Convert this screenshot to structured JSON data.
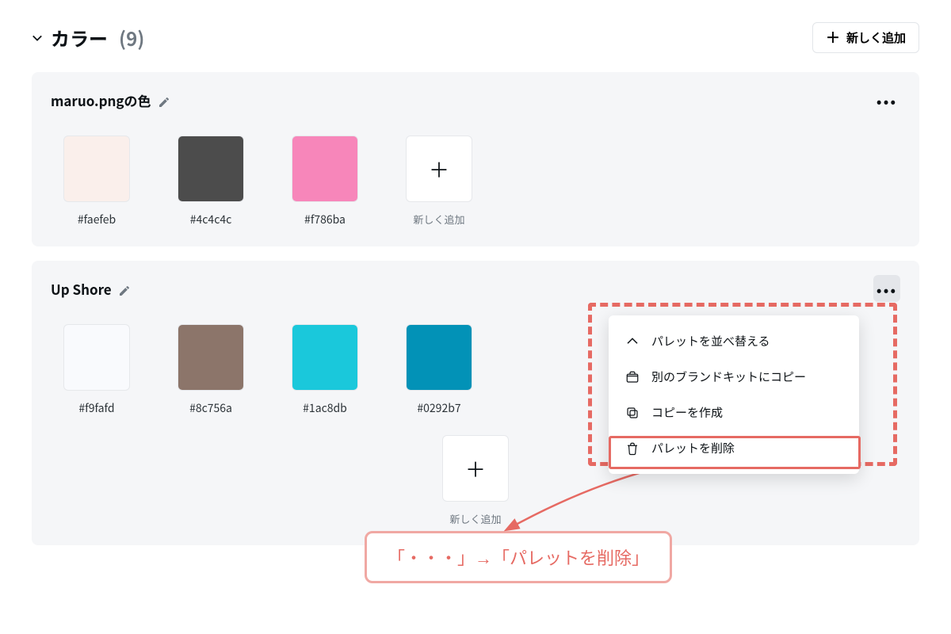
{
  "section": {
    "title": "カラー",
    "count": "(9)",
    "add_label": "新しく追加"
  },
  "palettes": [
    {
      "name": "maruo.pngの色",
      "colors": [
        {
          "hex": "#faefeb"
        },
        {
          "hex": "#4c4c4c"
        },
        {
          "hex": "#f786ba"
        }
      ],
      "add_label": "新しく追加",
      "menu_open": false
    },
    {
      "name": "Up Shore",
      "colors": [
        {
          "hex": "#f9fafd"
        },
        {
          "hex": "#8c756a"
        },
        {
          "hex": "#1ac8db"
        },
        {
          "hex": "#0292b7"
        }
      ],
      "add_label": "新しく追加",
      "menu_open": true
    }
  ],
  "menu": {
    "items": [
      {
        "icon": "chevron-up",
        "label": "パレットを並べ替える"
      },
      {
        "icon": "brand-kit",
        "label": "別のブランドキットにコピー"
      },
      {
        "icon": "copy",
        "label": "コピーを作成"
      },
      {
        "icon": "trash",
        "label": "パレットを削除"
      }
    ]
  },
  "annotation": {
    "text": "「・・・」→「パレットを削除」"
  }
}
